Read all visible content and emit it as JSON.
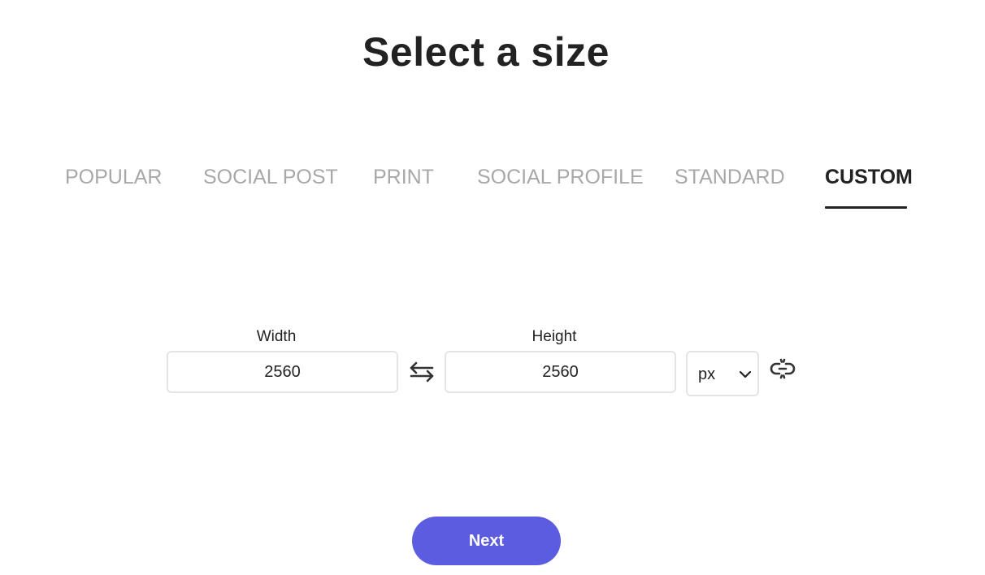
{
  "page": {
    "title": "Select a size"
  },
  "tabs": [
    {
      "label": "POPULAR",
      "active": false
    },
    {
      "label": "SOCIAL POST",
      "active": false
    },
    {
      "label": "PRINT",
      "active": false
    },
    {
      "label": "SOCIAL PROFILE",
      "active": false
    },
    {
      "label": "STANDARD",
      "active": false
    },
    {
      "label": "CUSTOM",
      "active": true
    }
  ],
  "custom_size": {
    "width_label": "Width",
    "width_value": "2560",
    "height_label": "Height",
    "height_value": "2560",
    "unit": "px",
    "swap_icon": "swap-arrows-icon",
    "link_icon": "unlink-chain-icon",
    "aspect_locked": false
  },
  "actions": {
    "next_label": "Next"
  },
  "colors": {
    "accent": "#5c5ce0",
    "tab_inactive": "#a8a8a8",
    "text": "#222222",
    "input_border": "#e4e4e4"
  }
}
